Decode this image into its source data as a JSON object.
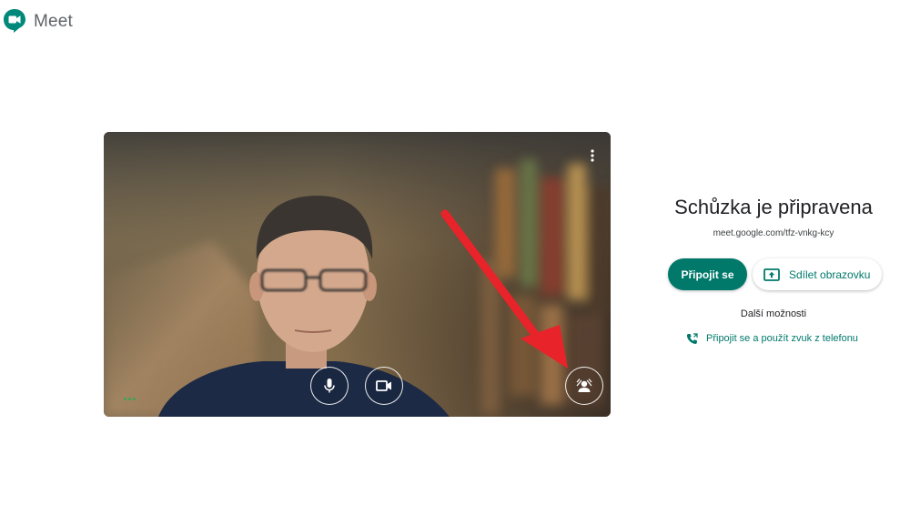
{
  "app": {
    "name": "Meet",
    "logo_icon": "google-meet-logo-icon"
  },
  "preview": {
    "more_icon": "more-vert-icon",
    "mic_icon": "microphone-icon",
    "camera_icon": "video-camera-icon",
    "background_icon": "change-background-icon",
    "audio_indicator_icon": "audio-level-dots-icon"
  },
  "panel": {
    "title": "Schůzka je připravena",
    "meeting_url": "meet.google.com/tfz-vnkg-kcy",
    "join_label": "Připojit se",
    "share_label": "Sdílet obrazovku",
    "share_icon": "present-screen-icon",
    "more_options_label": "Další možnosti",
    "phone_label": "Připojit se a použít zvuk z telefonu",
    "phone_icon": "phone-forward-icon"
  },
  "colors": {
    "accent": "#00796b",
    "annotation_arrow": "#e8232a",
    "audio_dots": "#34a853"
  }
}
